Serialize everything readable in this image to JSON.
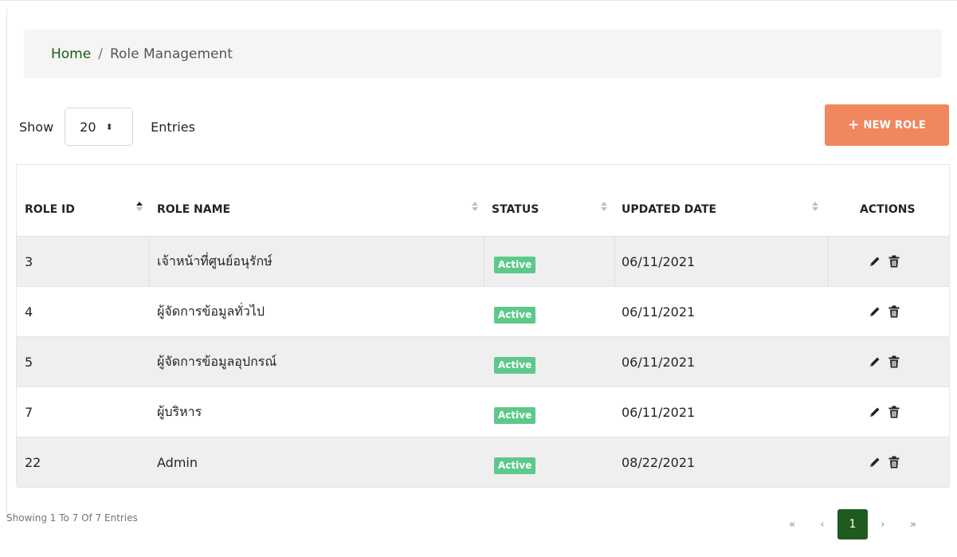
{
  "breadcrumb": {
    "home": "Home",
    "separator": "/",
    "current": "Role Management"
  },
  "entries": {
    "show_label": "Show",
    "value": "20",
    "after_label": "Entries"
  },
  "new_role_button": {
    "plus": "+",
    "label": "NEW ROLE"
  },
  "table": {
    "headers": [
      "ROLE ID",
      "ROLE NAME",
      "STATUS",
      "UPDATED DATE",
      "ACTIONS"
    ],
    "rows": [
      {
        "role_id": "3",
        "role_name": "เจ้าหน้าที่ศูนย์อนุรักษ์",
        "status": "Active",
        "updated_date": "06/11/2021"
      },
      {
        "role_id": "4",
        "role_name": "ผู้จัดการข้อมูลทั่วไป",
        "status": "Active",
        "updated_date": "06/11/2021"
      },
      {
        "role_id": "5",
        "role_name": "ผู้จัดการข้อมูลอุปกรณ์",
        "status": "Active",
        "updated_date": "06/11/2021"
      },
      {
        "role_id": "7",
        "role_name": "ผู้บริหาร",
        "status": "Active",
        "updated_date": "06/11/2021"
      },
      {
        "role_id": "22",
        "role_name": "Admin",
        "status": "Active",
        "updated_date": "08/22/2021"
      }
    ]
  },
  "footer": {
    "info": "Showing 1 To 7 Of 7 Entries",
    "pagination": {
      "first": "«",
      "prev": "‹",
      "current": "1",
      "next": "›",
      "last": "»"
    }
  },
  "colors": {
    "accent_button": "#f0875e",
    "active_badge": "#5cc98b",
    "current_page": "#1f5a1f",
    "home_link": "#1c5a1c"
  },
  "icons": {
    "edit": "pencil-icon",
    "delete": "trash-icon",
    "sort": "sort-icon",
    "select": "updown-chevron-icon"
  }
}
